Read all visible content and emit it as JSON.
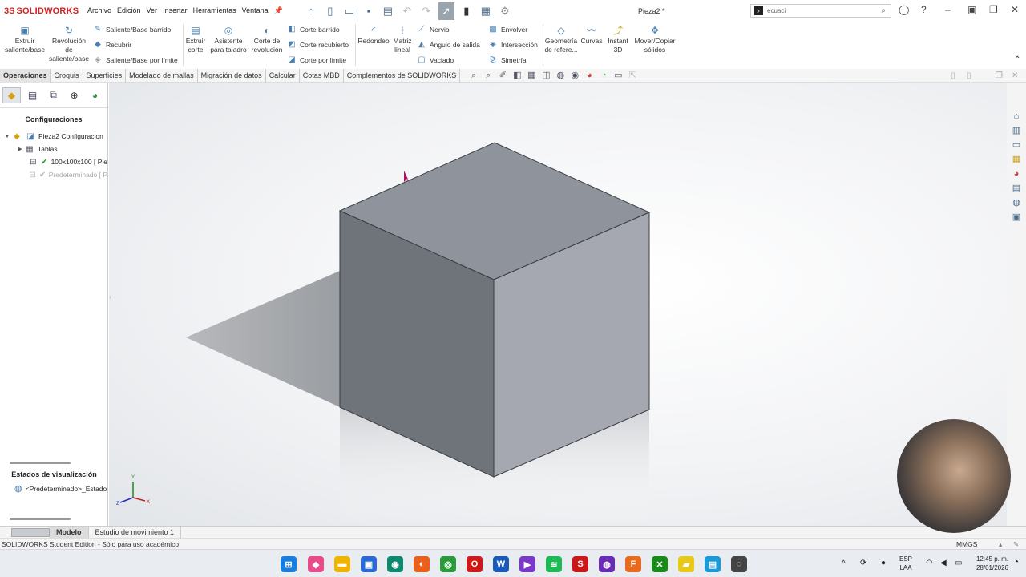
{
  "app": {
    "brand_ds": "3S",
    "brand": "SOLIDWORKS",
    "doc_title": "Pieza2 *",
    "menus": [
      "Archivo",
      "Edición",
      "Ver",
      "Insertar",
      "Herramientas",
      "Ventana"
    ],
    "search": {
      "value": "ecuaci",
      "placeholder": ""
    }
  },
  "ribbon": {
    "extruir": "Extruir saliente/base",
    "revolucion": "Revolución de saliente/base",
    "barrido": "Saliente/Base barrido",
    "recubrir": "Recubrir",
    "limite": "Saliente/Base por límite",
    "extruir_corte": "Extruir corte",
    "asistente": "Asistente para taladro",
    "corte_rev": "Corte de revolución",
    "corte_barrido": "Corte barrido",
    "corte_recubierto": "Corte recubierto",
    "corte_limite": "Corte por límite",
    "redondeo": "Redondeo",
    "matriz": "Matriz lineal",
    "nervio": "Nervio",
    "angulo": "Ángulo de salida",
    "vaciado": "Vaciado",
    "envolver": "Envolver",
    "interseccion": "Intersección",
    "simetria": "Simetría",
    "geometria": "Geometría de refere...",
    "curvas": "Curvas",
    "instant3d": "Instant 3D",
    "mover": "Mover/Copiar sólidos"
  },
  "tabs": [
    "Operaciones",
    "Croquis",
    "Superficies",
    "Modelado de mallas",
    "Migración de datos",
    "Calcular",
    "Cotas MBD",
    "Complementos de SOLIDWORKS"
  ],
  "left_panel": {
    "header": "Configuraciones",
    "tree": [
      {
        "label": "Pieza2 Configuracion"
      },
      {
        "label": "Tablas"
      },
      {
        "label": "100x100x100 [ Pie"
      },
      {
        "label": "Predeterminado [ P"
      }
    ],
    "vis_header": "Estados de visualización",
    "vis_item": "<Predeterminado>_Estado"
  },
  "bottom_tabs": [
    "Modelo",
    "Estudio de movimiento 1"
  ],
  "status": {
    "text": "SOLIDWORKS Student Edition - Sólo para uso académico",
    "units": "MMGS"
  },
  "taskbar": {
    "lang1": "ESP",
    "lang2": "LAA",
    "time": "12:45 p. m.",
    "date": "28/01/2026"
  }
}
